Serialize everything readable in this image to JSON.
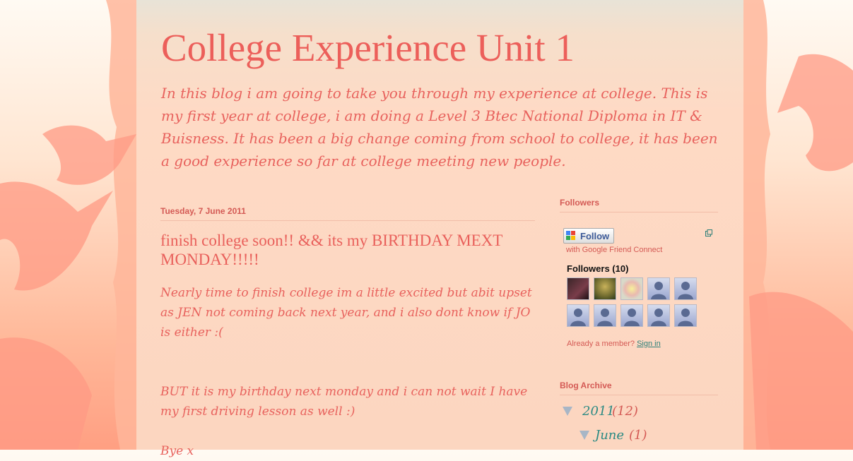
{
  "blog": {
    "title": "College Experience Unit 1",
    "description": "In this blog i am going to take you through my experience at college. This is my first year at college, i am doing a Level 3 Btec National Diploma in IT & Buisness. It has been a big change coming from school to college, it has been a good experience so far at college meeting new people."
  },
  "post": {
    "date": "Tuesday, 7 June 2011",
    "title": "finish college soon!! && its my BIRTHDAY MEXT MONDAY!!!!!",
    "paragraphs": [
      "Nearly time to finish college im a little excited but abit upset as JEN not coming back next year, and i also dont know if JO is either :(",
      "BUT it is my birthday next monday and i can not wait I have my first driving lesson as well :)",
      "Bye x"
    ]
  },
  "sidebar": {
    "followers_widget": {
      "title": "Followers",
      "follow_label": "Follow",
      "gfc_text": "with Google Friend Connect",
      "followers_heading": "Followers (10)",
      "avatars": [
        "photo-avatar",
        "photo-avatar",
        "photo-avatar",
        "default-avatar",
        "default-avatar",
        "default-avatar",
        "default-avatar",
        "default-avatar",
        "default-avatar",
        "default-avatar"
      ],
      "member_text": "Already a member?",
      "signin_label": "Sign in"
    },
    "archive_widget": {
      "title": "Blog Archive",
      "year": "2011",
      "year_count": "(12)",
      "month": "June",
      "month_count": "(1)"
    }
  },
  "colors": {
    "accent": "#ec5f5a",
    "link": "#2b8a83"
  }
}
